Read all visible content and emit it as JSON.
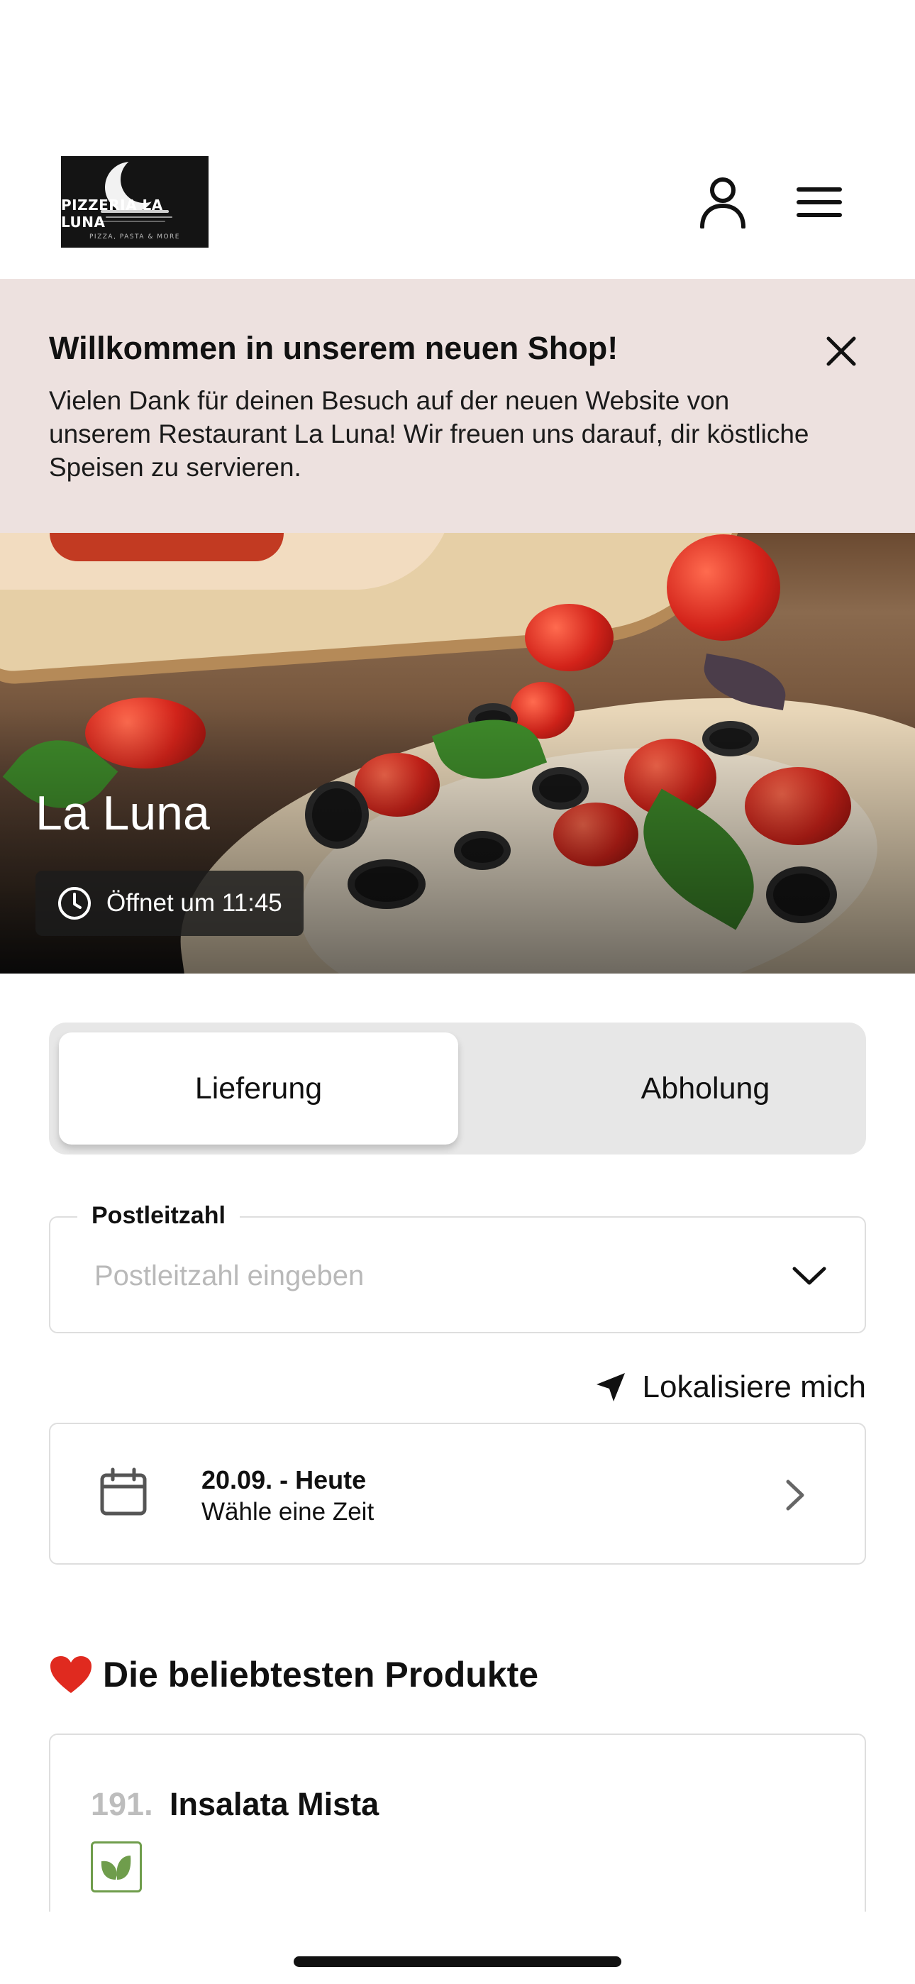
{
  "header": {
    "logo": {
      "name": "PIZZERIA LA LUNA",
      "tagline": "PIZZA, PASTA & MORE"
    },
    "icons": {
      "account": "user-icon",
      "menu": "hamburger-menu-icon"
    }
  },
  "banner": {
    "title": "Willkommen in unserem neuen Shop!",
    "text": "Vielen Dank für deinen Besuch auf der neuen Website von unserem Restaurant La Luna! Wir freuen uns darauf, dir köstliche Speisen zu servieren.",
    "close_icon": "close-icon",
    "background": "#ede1df"
  },
  "hero": {
    "title": "La Luna",
    "opening_status": "Öffnet um 11:45",
    "status_icon": "clock-icon"
  },
  "delivery_mode": {
    "options": [
      "Lieferung",
      "Abholung"
    ],
    "selected": "Lieferung"
  },
  "postal_code": {
    "label": "Postleitzahl",
    "placeholder": "Postleitzahl eingeben",
    "value": "",
    "dropdown_icon": "chevron-down-icon"
  },
  "locate": {
    "label": "Lokalisiere mich",
    "icon": "location-arrow-icon"
  },
  "date_picker": {
    "date": "20.09. - Heute",
    "subtitle": "Wähle eine Zeit",
    "icon": "calendar-icon",
    "arrow_icon": "chevron-right-icon"
  },
  "popular": {
    "title": "Die beliebtesten Produkte",
    "emoji": "heart-icon",
    "products": [
      {
        "number": "191.",
        "name": "Insalata Mista",
        "badge": "vegetarian-leaf-icon"
      }
    ]
  }
}
